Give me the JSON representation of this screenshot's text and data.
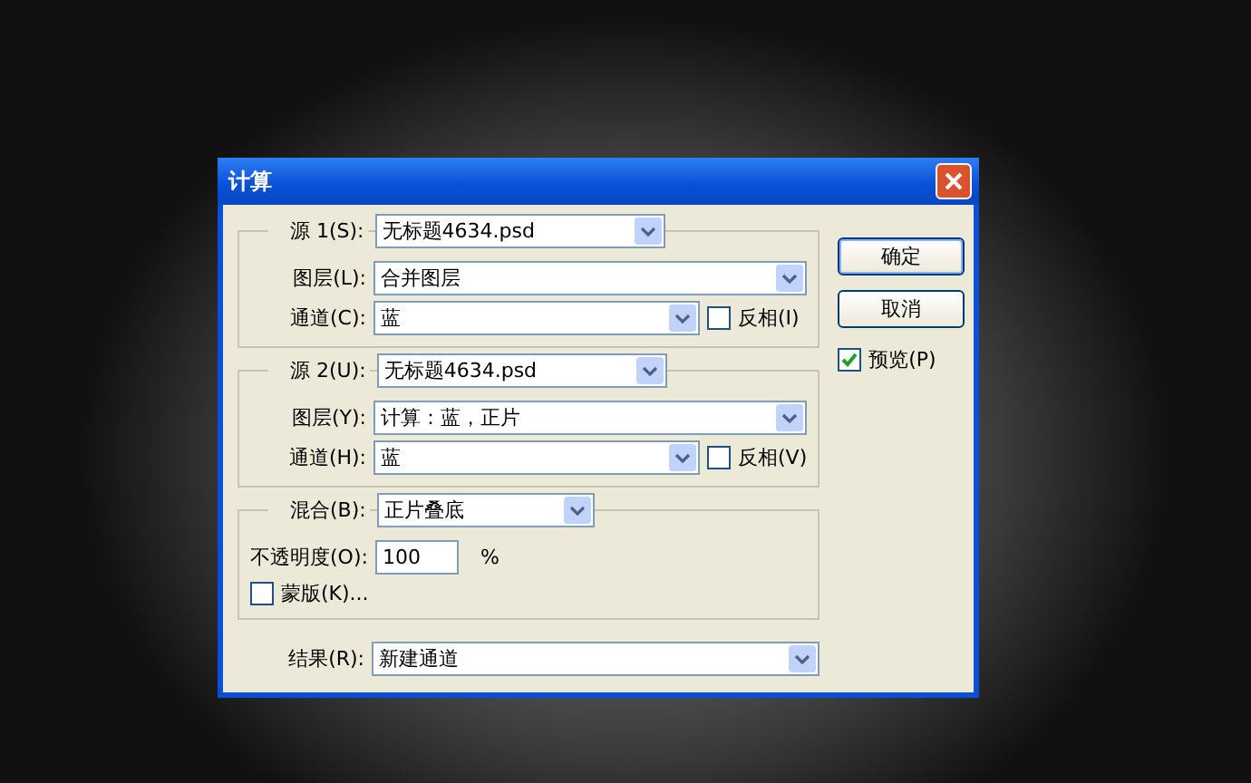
{
  "window": {
    "title": "计算"
  },
  "source1": {
    "label": "源 1(S):",
    "file": "无标题4634.psd",
    "layer_label": "图层(L):",
    "layer": "合并图层",
    "channel_label": "通道(C):",
    "channel": "蓝",
    "invert": {
      "label": "反相(I)",
      "checked": false
    }
  },
  "source2": {
    "label": "源 2(U):",
    "file": "无标题4634.psd",
    "layer_label": "图层(Y):",
    "layer": "计算：蓝，正片",
    "channel_label": "通道(H):",
    "channel": "蓝",
    "invert": {
      "label": "反相(V)",
      "checked": false
    }
  },
  "blending": {
    "label": "混合(B):",
    "mode": "正片叠底",
    "opacity_label": "不透明度(O):",
    "opacity": "100",
    "unit": "%",
    "mask": {
      "label": "蒙版(K)...",
      "checked": false
    }
  },
  "result": {
    "label": "结果(R):",
    "value": "新建通道"
  },
  "buttons": [
    {
      "label": "确定",
      "default": true
    },
    {
      "label": "取消",
      "default": false
    }
  ],
  "preview": {
    "label": "预览(P)",
    "checked": true
  }
}
